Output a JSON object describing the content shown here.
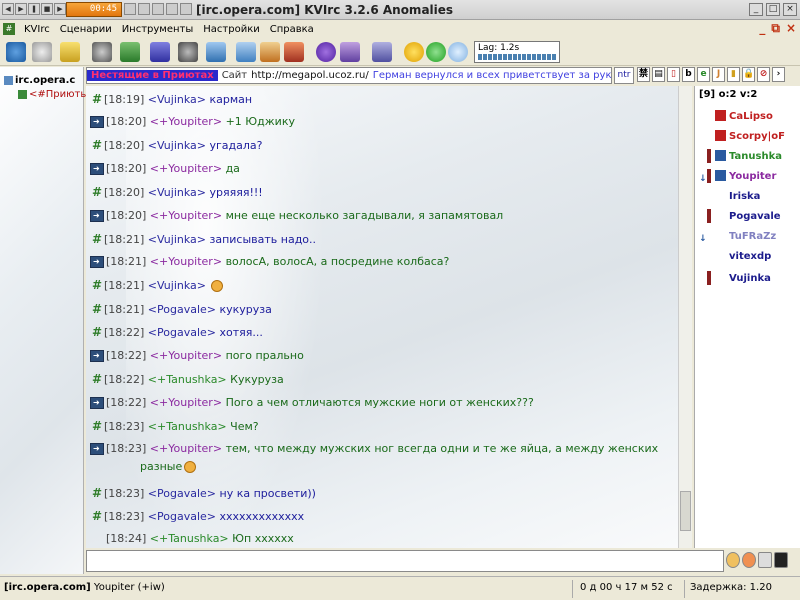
{
  "titlebar": {
    "media_time": "00:45",
    "title": "[irc.opera.com] KVIrc 3.2.6 Anomalies"
  },
  "menu": {
    "items": [
      "KVIrc",
      "Сценарии",
      "Инструменты",
      "Настройки",
      "Справка"
    ]
  },
  "lag": {
    "label": "Lag: 1.2s"
  },
  "tree": {
    "server": "irc.opera.c",
    "channel": "<#Приюты"
  },
  "topic": {
    "chan_tag": "Нестящие в Приютах",
    "site_label": "Сайт",
    "url": "http://megapol.ucoz.ru/",
    "notice": "Герман вернулся и всех приветствует за руку!!!",
    "mode_label": "ntr"
  },
  "messages": [
    {
      "icon": "hash",
      "time": "[18:19]",
      "nick": "<Vujinka>",
      "text": "карман"
    },
    {
      "icon": "arrow",
      "time": "[18:20]",
      "nick": "<+Youpiter>",
      "text": "+1 Юджику"
    },
    {
      "icon": "hash",
      "time": "[18:20]",
      "nick": "<Vujinka>",
      "text": "угадала?"
    },
    {
      "icon": "arrow",
      "time": "[18:20]",
      "nick": "<+Youpiter>",
      "text": "да"
    },
    {
      "icon": "hash",
      "time": "[18:20]",
      "nick": "<Vujinka>",
      "text": "уряяяя!!!"
    },
    {
      "icon": "arrow",
      "time": "[18:20]",
      "nick": "<+Youpiter>",
      "text": "мне еще несколько загадывали, я запамятовал"
    },
    {
      "icon": "hash",
      "time": "[18:21]",
      "nick": "<Vujinka>",
      "text": "записывать надо.."
    },
    {
      "icon": "arrow",
      "time": "[18:21]",
      "nick": "<+Youpiter>",
      "text": "волосА, волосА, а посредине колбаса?"
    },
    {
      "icon": "hash",
      "time": "[18:21]",
      "nick": "<Vujinka>",
      "text": ""
    },
    {
      "icon": "hash",
      "time": "[18:21]",
      "nick": "<Pogavale>",
      "text": "кукуруза"
    },
    {
      "icon": "hash",
      "time": "[18:22]",
      "nick": "<Pogavale>",
      "text": "хотяя..."
    },
    {
      "icon": "arrow",
      "time": "[18:22]",
      "nick": "<+Youpiter>",
      "text": "пого прально"
    },
    {
      "icon": "hash",
      "time": "[18:22]",
      "nick": "<+Tanushka>",
      "text": "Кукуруза"
    },
    {
      "icon": "arrow",
      "time": "[18:22]",
      "nick": "<+Youpiter>",
      "text": "Пого а чем отличаются мужские ноги от женских???"
    },
    {
      "icon": "hash",
      "time": "[18:23]",
      "nick": "<+Tanushka>",
      "text": "Чем?"
    },
    {
      "icon": "arrow",
      "time": "[18:23]",
      "nick": "<+Youpiter>",
      "text": "тем, что между мужских ног всегда одни и те же яйца, а между женских"
    },
    {
      "icon": "hash",
      "time": "[18:23]",
      "nick": "<Pogavale>",
      "text": "ну ка просвети))"
    },
    {
      "icon": "hash",
      "time": "[18:23]",
      "nick": "<Pogavale>",
      "text": "ххххххххххххх"
    },
    {
      "icon": "none",
      "time": "[18:24]",
      "nick": "<+Tanushka>",
      "text": "Юп хххххх"
    }
  ],
  "wrap_continuation": "разные",
  "userlist": {
    "header": "[9] o:2 v:2",
    "users": [
      {
        "name": "CaLipso",
        "color": "#c02020",
        "role": "op"
      },
      {
        "name": "Scorpy|oF",
        "color": "#c02020",
        "role": "op"
      },
      {
        "name": "Tanushka",
        "color": "#2a8a2a",
        "role": "voice"
      },
      {
        "name": "Youpiter",
        "color": "#8b2aa0",
        "role": "voice"
      },
      {
        "name": "Iriska",
        "color": "#1c1c8c",
        "role": "none"
      },
      {
        "name": "Pogavale",
        "color": "#1c1c8c",
        "role": "none"
      },
      {
        "name": "TuFRaZz",
        "color": "#8080c0",
        "role": "none"
      },
      {
        "name": "vitexdp",
        "color": "#1c1c8c",
        "role": "none"
      },
      {
        "name": "Vujinka",
        "color": "#1c1c8c",
        "role": "none"
      }
    ]
  },
  "status": {
    "server": "[irc.opera.com]",
    "user": "Youpiter (+iw)",
    "uptime": "0 д 00 ч 17 м 52 с",
    "lag": "Задержка: 1.20"
  }
}
